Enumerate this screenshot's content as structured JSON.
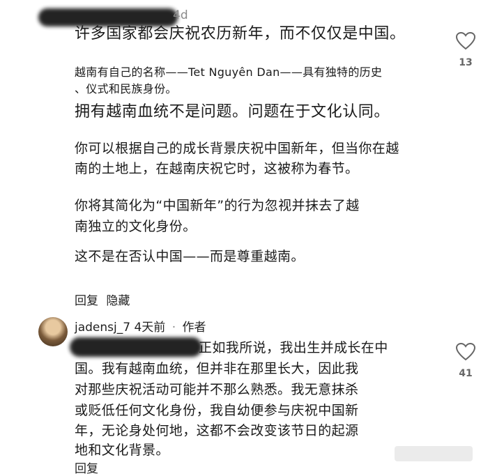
{
  "comment1": {
    "time_fragment": "4d",
    "lines": {
      "l1": "许多国家都会庆祝农历新年，而不仅仅是中国。",
      "l2a": "越南有自己的名称——Tet Nguyên Dan——具有独特的历史",
      "l2b": "、仪式和民族身份。",
      "l3": "拥有越南血统不是问题。问题在于文化认同。",
      "l4a": "你可以根据自己的成长背景庆祝中国新年，但当你在越",
      "l4b": "南的土地上，在越南庆祝它时，这被称为春节。",
      "l5a": "你将其简化为“中国新年”的行为忽视并抹去了越",
      "l5b": "南独立的文化身份。",
      "l6": "这不是在否认中国——而是尊重越南。"
    },
    "reply_label": "回复",
    "hide_label": "隐藏",
    "like_icon": "heart-outline-icon",
    "like_count": "13"
  },
  "comment2": {
    "username": "jadensj_7",
    "time": "4天前",
    "dot": "·",
    "role": "作者",
    "lines": {
      "l1": "正如我所说，我出生并成长在中",
      "l2": "国。我有越南血统，但并非在那里长大，因此我",
      "l3": "对那些庆祝活动可能并不那么熟悉。我无意抹杀",
      "l4": "或贬低任何文化身份，我自幼便参与庆祝中国新",
      "l5": "年，无论身处何地，这都不会改变该节日的起源",
      "l6": "地和文化背景。"
    },
    "reply_partial": "回复",
    "like_icon": "heart-outline-icon",
    "like_count": "41"
  }
}
